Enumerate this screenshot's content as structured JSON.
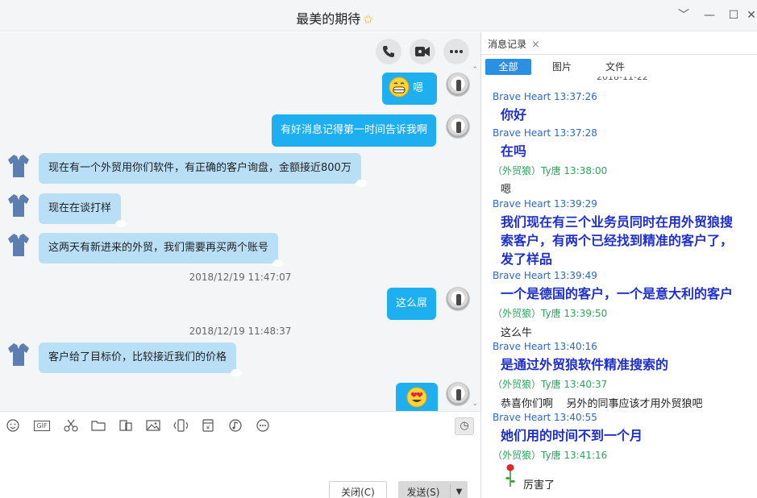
{
  "window": {
    "title": "最美的期待",
    "minimize": "﹀",
    "min2": "—",
    "maximize": "☐",
    "close": "✕"
  },
  "chat": {
    "messages": [
      {
        "side": "me",
        "text": "嗯",
        "emoji": "grin"
      },
      {
        "side": "me",
        "text": "有好消息记得第一时间告诉我啊"
      },
      {
        "side": "other",
        "text": "现在有一个外贸用你们软件，有正确的客户询盘，金额接近800万"
      },
      {
        "side": "other",
        "text": "现在在谈打样"
      },
      {
        "side": "other",
        "text": "这两天有新进来的外贸，我们需要再买两个账号"
      },
      {
        "side": "time",
        "text": "2018/12/19 11:47:07"
      },
      {
        "side": "me",
        "text": "这么屌"
      },
      {
        "side": "time",
        "text": "2018/12/19 11:48:37"
      },
      {
        "side": "other",
        "text": "客户给了目标价，比较接近我们的价格"
      },
      {
        "side": "me",
        "text": "",
        "emoji": "heart-eyes"
      }
    ]
  },
  "input": {
    "toolbar": [
      "emoji-icon",
      "gif-icon",
      "scissors-icon",
      "folder-icon",
      "screenshot-icon",
      "image-icon",
      "shake-icon",
      "red-packet-icon",
      "music-icon",
      "more-icon"
    ],
    "gif_label": "GIF",
    "close_label": "关闭(C)",
    "send_label": "发送(S)",
    "send_drop": "▼",
    "clock": "◷"
  },
  "history": {
    "tab_label": "消息记录",
    "tab_close": "×",
    "filters": [
      "全部",
      "图片",
      "文件"
    ],
    "date_clip": "2018-11-22",
    "entries": [
      {
        "sender": "Brave Heart 13:37:26",
        "who": "me",
        "text": "你好"
      },
      {
        "sender": "Brave Heart 13:37:28",
        "who": "me",
        "text": "在吗"
      },
      {
        "sender": "（外贸狼）Ty唐 13:38:00",
        "who": "other",
        "text": "嗯"
      },
      {
        "sender": "Brave Heart 13:39:29",
        "who": "me",
        "text": "我们现在有三个业务员同时在用外贸狼搜索客户，有两个已经找到精准的客户了，发了样品"
      },
      {
        "sender": "Brave Heart 13:39:49",
        "who": "me",
        "text": "一个是德国的客户，一个是意大利的客户"
      },
      {
        "sender": "（外贸狼）Ty唐 13:39:50",
        "who": "other",
        "text": "这么牛"
      },
      {
        "sender": "Brave Heart 13:40:16",
        "who": "me",
        "text": "是通过外贸狼软件精准搜索的"
      },
      {
        "sender": "（外贸狼）Ty唐 13:40:37",
        "who": "other",
        "text": "恭喜你们啊    另外的同事应该才用外贸狼吧"
      },
      {
        "sender": "Brave Heart 13:40:55",
        "who": "me",
        "text": "她们用的时间不到一个月"
      },
      {
        "sender": "（外贸狼）Ty唐 13:41:16",
        "who": "other",
        "text": "厉害了"
      }
    ]
  }
}
